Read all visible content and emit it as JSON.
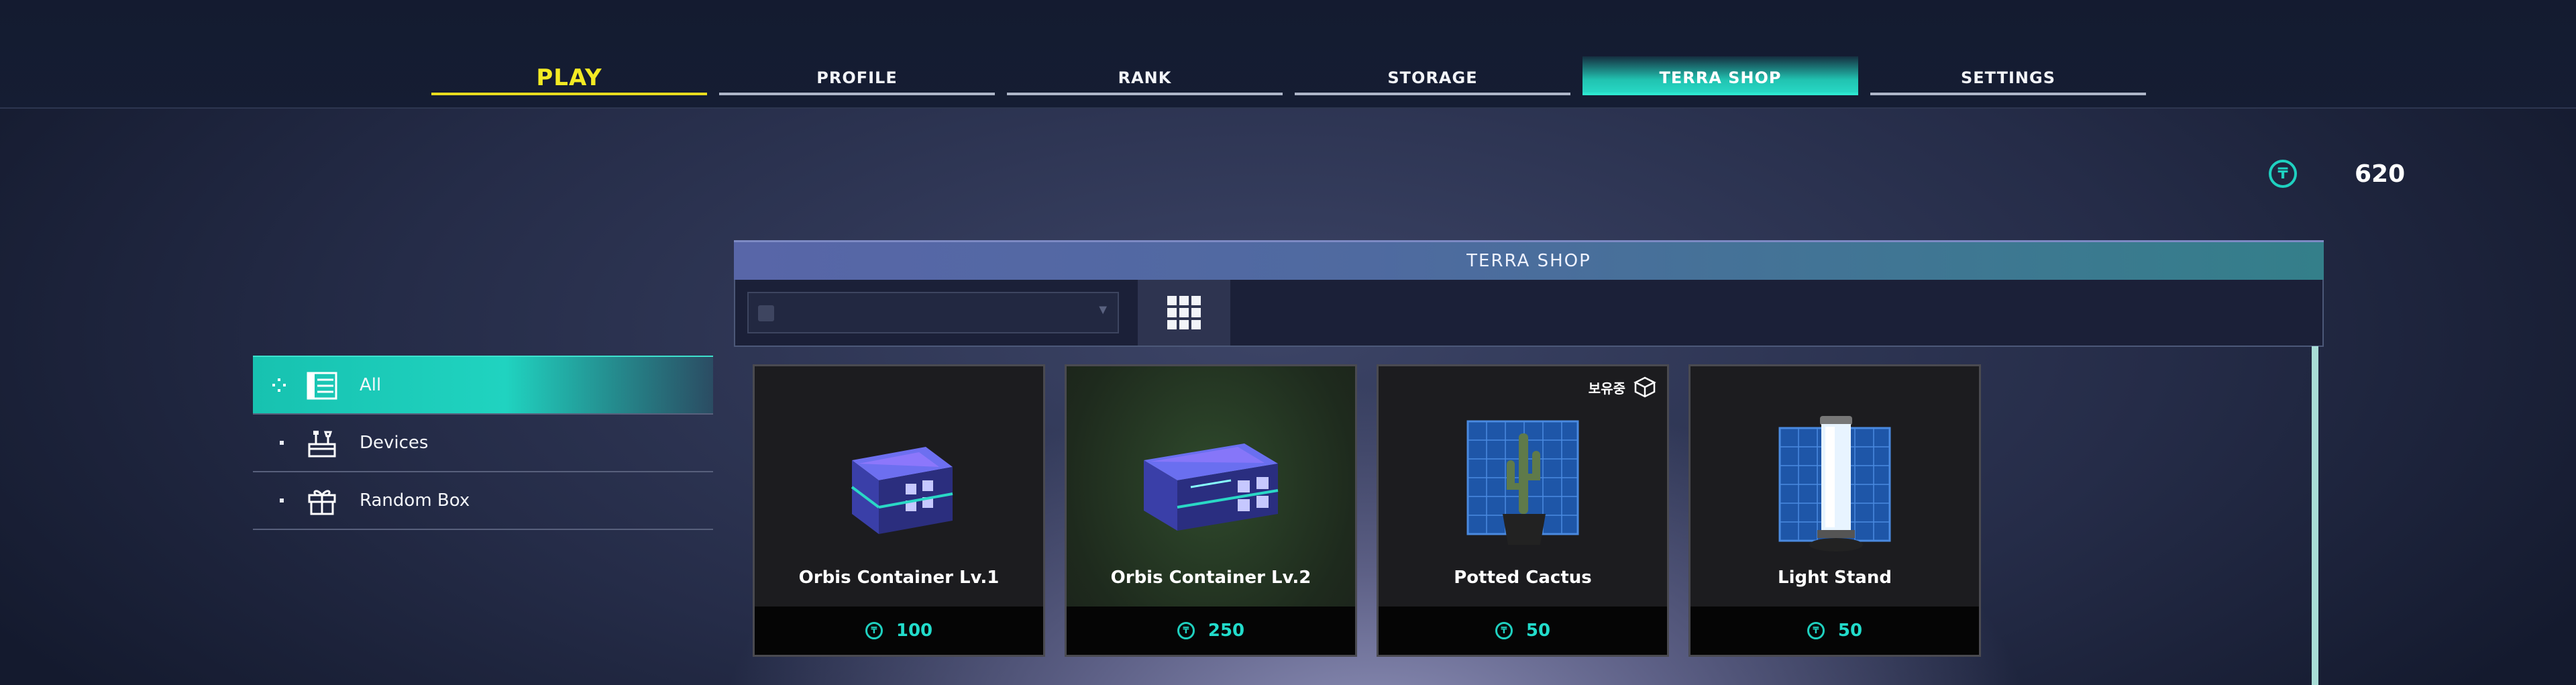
{
  "nav": {
    "tabs": [
      {
        "label": "PLAY",
        "state": "highlight"
      },
      {
        "label": "PROFILE",
        "state": "normal"
      },
      {
        "label": "RANK",
        "state": "normal"
      },
      {
        "label": "STORAGE",
        "state": "normal"
      },
      {
        "label": "TERRA SHOP",
        "state": "active"
      },
      {
        "label": "SETTINGS",
        "state": "normal"
      }
    ]
  },
  "currency": {
    "icon": "terra-coin-icon",
    "value": "620"
  },
  "sidebar": {
    "items": [
      {
        "label": "All",
        "icon": "list-icon",
        "selected": true
      },
      {
        "label": "Devices",
        "icon": "tools-icon",
        "selected": false
      },
      {
        "label": "Random Box",
        "icon": "gift-icon",
        "selected": false
      }
    ]
  },
  "shop": {
    "title": "TERRA SHOP",
    "view_mode_icon": "grid-view-icon",
    "items": [
      {
        "name": "Orbis Container Lv.1",
        "price": "100",
        "owned": false
      },
      {
        "name": "Orbis Container Lv.2",
        "price": "250",
        "owned": false
      },
      {
        "name": "Potted Cactus",
        "price": "50",
        "owned": true,
        "owned_label": "보유중"
      },
      {
        "name": "Light Stand",
        "price": "50",
        "owned": false
      }
    ]
  },
  "colors": {
    "accent": "#21c3b1",
    "play": "#f3ea24",
    "price": "#22dccb"
  }
}
